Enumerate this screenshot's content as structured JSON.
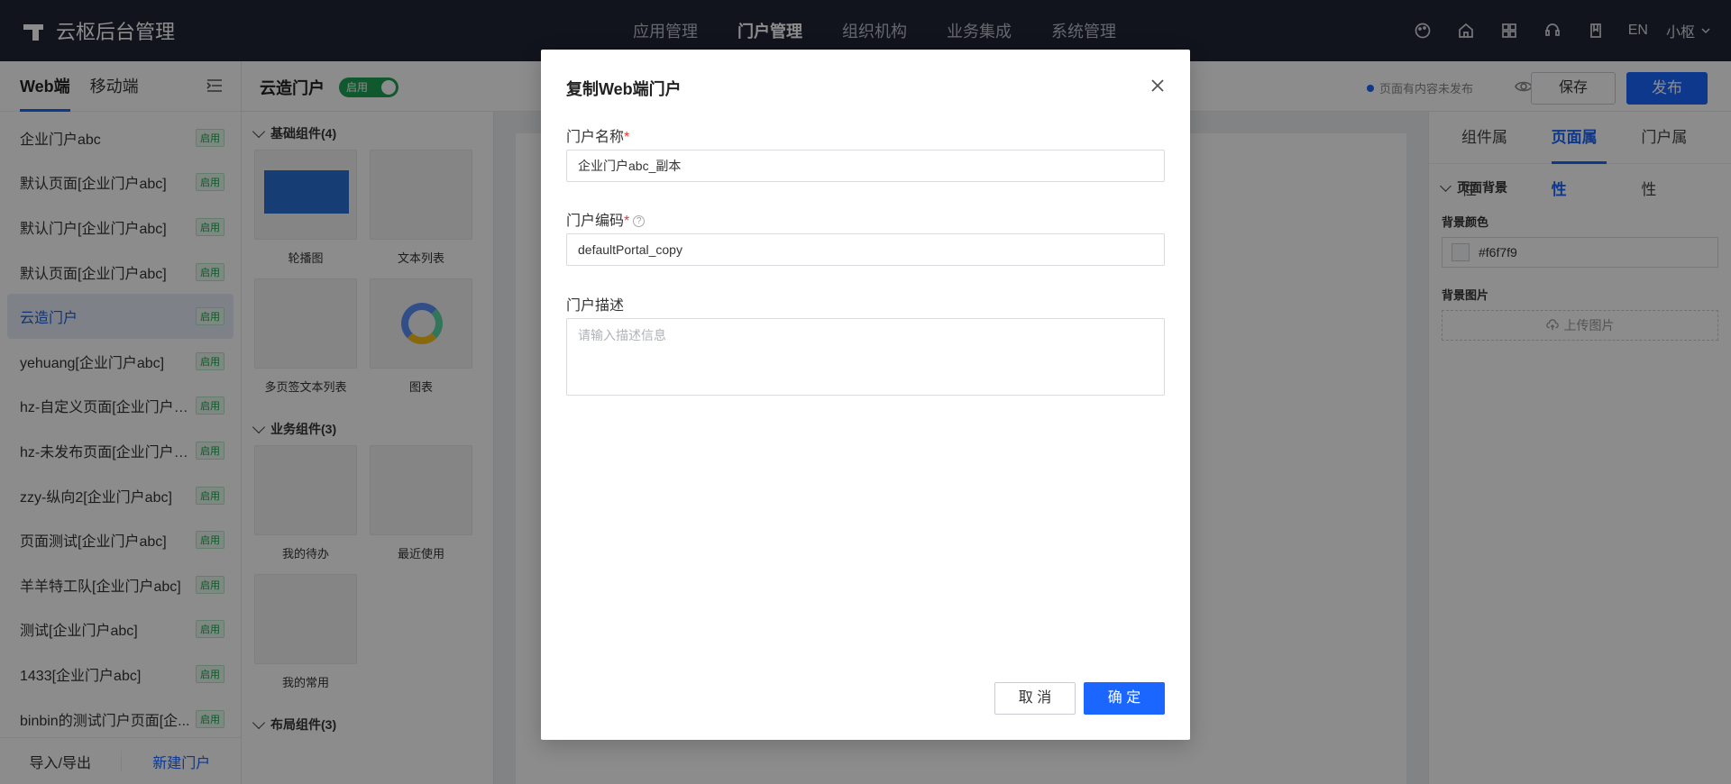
{
  "topbar": {
    "brand": "云枢后台管理",
    "nav": [
      "应用管理",
      "门户管理",
      "组织机构",
      "业务集成",
      "系统管理"
    ],
    "active_nav": "门户管理",
    "lang": "EN",
    "user": "小枢"
  },
  "left": {
    "tabs": [
      "Web端",
      "移动端"
    ],
    "items": [
      {
        "name": "企业门户abc",
        "badge": "启用"
      },
      {
        "name": "默认页面[企业门户abc]",
        "badge": "启用"
      },
      {
        "name": "默认门户[企业门户abc]",
        "badge": "启用"
      },
      {
        "name": "默认页面[企业门户abc]",
        "badge": "启用"
      },
      {
        "name": "云造门户",
        "badge": "启用"
      },
      {
        "name": "yehuang[企业门户abc]",
        "badge": "启用"
      },
      {
        "name": "hz-自定义页面[企业门户ab...",
        "badge": "启用"
      },
      {
        "name": "hz-未发布页面[企业门户ab...",
        "badge": "启用"
      },
      {
        "name": "zzy-纵向2[企业门户abc]",
        "badge": "启用"
      },
      {
        "name": "页面测试[企业门户abc]",
        "badge": "启用"
      },
      {
        "name": "羊羊特工队[企业门户abc]",
        "badge": "启用"
      },
      {
        "name": "测试[企业门户abc]",
        "badge": "启用"
      },
      {
        "name": "1433[企业门户abc]",
        "badge": "启用"
      },
      {
        "name": "binbin的测试门户页面[企...",
        "badge": "启用"
      }
    ],
    "footer_import": "导入/导出",
    "footer_new": "新建门户"
  },
  "header": {
    "portal_title": "云造门户",
    "toggle_label": "启用",
    "unpublished": "页面有内容未发布",
    "save": "保存",
    "publish": "发布"
  },
  "components": {
    "basic_group": "基础组件(4)",
    "basic": [
      "轮播图",
      "文本列表",
      "多页签文本列表",
      "图表"
    ],
    "business_group": "业务组件(3)",
    "business": [
      "我的待办",
      "最近使用",
      "我的常用"
    ],
    "layout_group": "布局组件(3)"
  },
  "right": {
    "tabs": [
      "组件属性",
      "页面属性",
      "门户属性"
    ],
    "section": "页面背景",
    "bg_color_label": "背景颜色",
    "bg_color_value": "#f6f7f9",
    "bg_image_label": "背景图片",
    "upload_label": "上传图片"
  },
  "modal": {
    "title": "复制Web端门户",
    "name_label": "门户名称",
    "name_value": "企业门户abc_副本",
    "code_label": "门户编码",
    "code_value": "defaultPortal_copy",
    "desc_label": "门户描述",
    "desc_placeholder": "请输入描述信息",
    "cancel": "取 消",
    "confirm": "确 定",
    "required_mark": "*"
  },
  "colors": {
    "primary": "#1a66ff",
    "topbar": "#1f2533",
    "success": "#1ea052"
  }
}
